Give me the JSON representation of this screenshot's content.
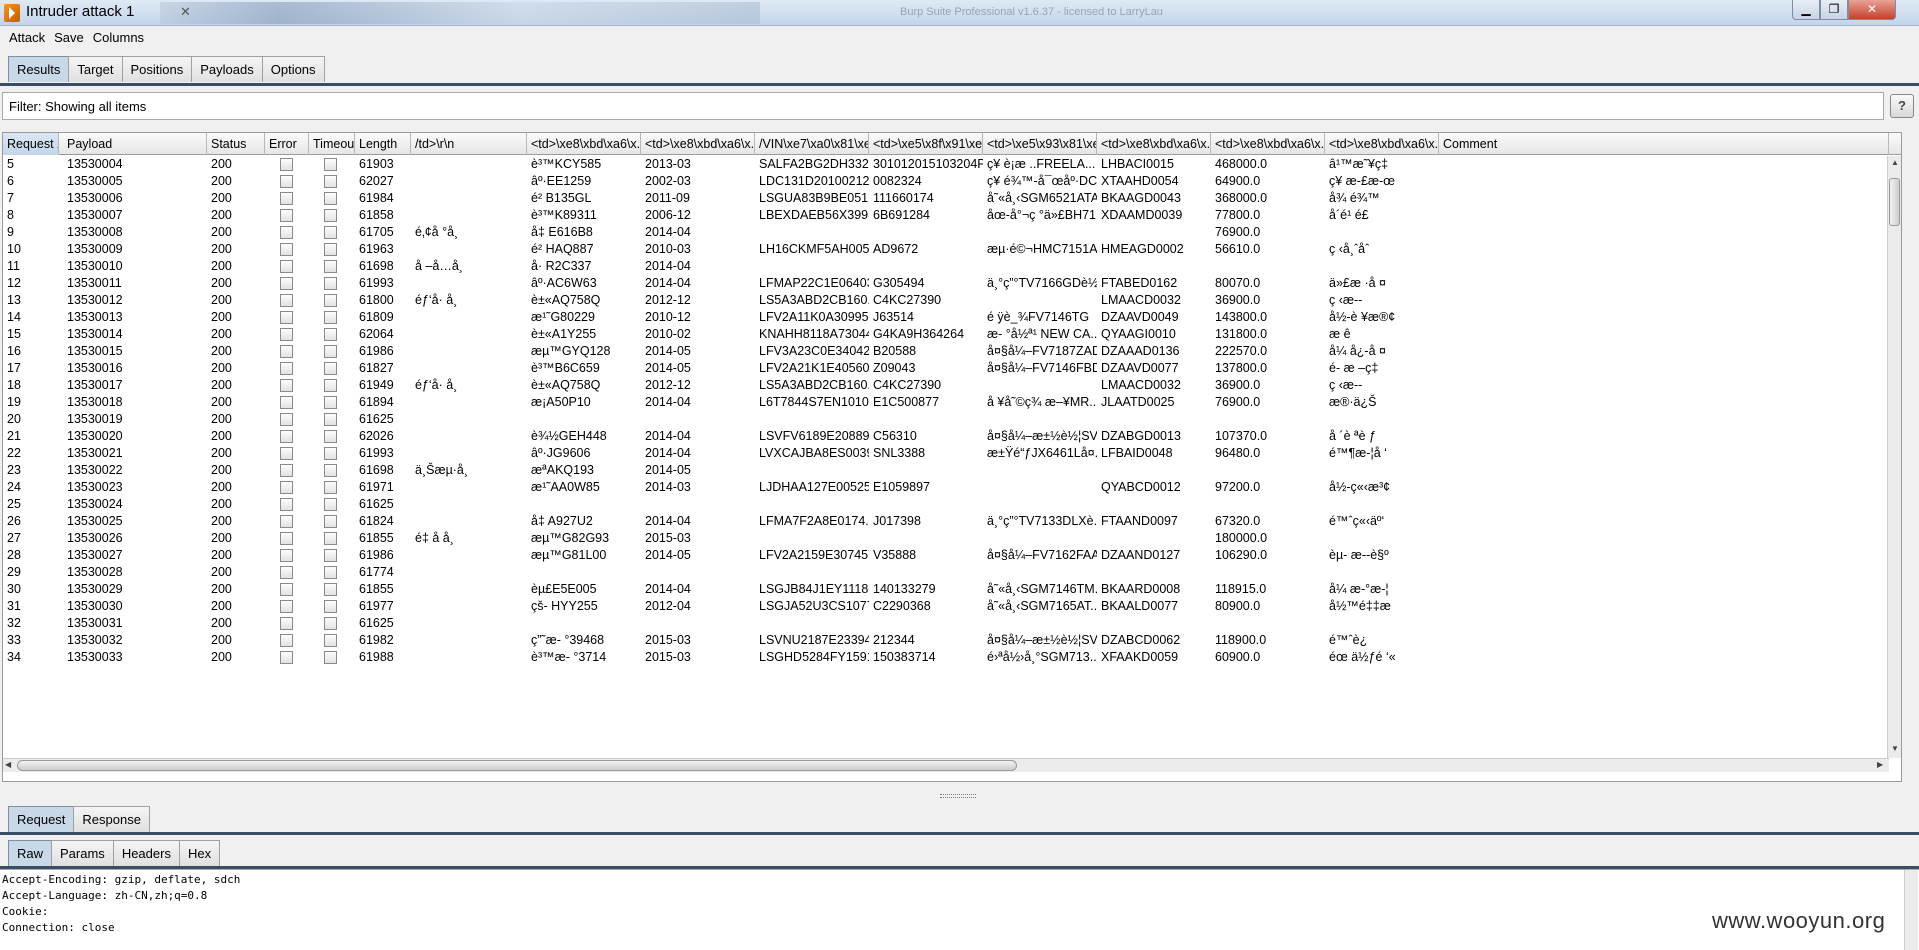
{
  "window": {
    "title": "Intruder attack 1",
    "background_title": "Burp Suite Professional v1.6.37 - licensed to LarryLau"
  },
  "menu": [
    "Attack",
    "Save",
    "Columns"
  ],
  "top_tabs": [
    "Results",
    "Target",
    "Positions",
    "Payloads",
    "Options"
  ],
  "top_tabs_active": 0,
  "filter": {
    "text": "Filter: Showing all items",
    "help": "?"
  },
  "columns": [
    "Request",
    "Payload",
    "Status",
    "Error",
    "Timeout",
    "Length",
    "/td>\\r\\n",
    "<td>\\xe8\\xbd\\xa6\\x...",
    "<td>\\xe8\\xbd\\xa6\\x...",
    "/VIN\\xe7\\xa0\\x81\\xe...",
    "<td>\\xe5\\x8f\\x91\\xe...",
    "<td>\\xe5\\x93\\x81\\xe...",
    "<td>\\xe8\\xbd\\xa6\\x...",
    "<td>\\xe8\\xbd\\xa6\\x...",
    "<td>\\xe8\\xbd\\xa6\\x...",
    "Comment"
  ],
  "rows": [
    [
      "5",
      "13530004",
      "200",
      "61903",
      "",
      "è³™KCY585",
      "2013-03",
      "SALFA2BG2DH332...",
      "301012015103204PT",
      "ç¥ è¡æ ..FREELA...",
      "LHBACI0015",
      "468000.0",
      "â¹™æ˜¥ç‡"
    ],
    [
      "6",
      "13530005",
      "200",
      "62027",
      "",
      "âº·EE1259",
      "2002-03",
      "LDC131D2010021277",
      "0082324",
      "ç¥ é¾™-å¯œåº·DC7...",
      "XTAAHD0054",
      "64900.0",
      "ç¥ æ-£æ-œ"
    ],
    [
      "7",
      "13530006",
      "200",
      "61984",
      "",
      "é² B135GL",
      "2011-09",
      "LSGUA83B9BE051...",
      "111660174",
      "å˜«å¸‹SGM6521ATA",
      "BKAAGD0043",
      "368000.0",
      "å¾ é¾™"
    ],
    [
      "8",
      "13530007",
      "200",
      "61858",
      "",
      "è³™K89311",
      "2006-12",
      "LBEXDAEB56X3993...",
      "6B691284",
      "åœ-å°¬ç °ä»£BH71...",
      "XDAAMD0039",
      "77800.0",
      "å´é¹ é£"
    ],
    [
      "9",
      "13530008",
      "200",
      "61705",
      "é‚¢å °å¸",
      "å‡ E616B8",
      "2014-04",
      "",
      "",
      "",
      "",
      "76900.0",
      ""
    ],
    [
      "10",
      "13530009",
      "200",
      "61963",
      "",
      "é² HAQ887",
      "2010-03",
      "LH16CKMF5AH005...",
      "AD9672",
      "æµ·é©¬HMC7151A...",
      "HMEAGD0002",
      "56610.0",
      "ç ‹å¸ˆåˆ"
    ],
    [
      "11",
      "13530010",
      "200",
      "61698",
      "å –å…å¸",
      "å· R2C337",
      "2014-04",
      "",
      "",
      "",
      "",
      "",
      ""
    ],
    [
      "12",
      "13530011",
      "200",
      "61993",
      "",
      "âº·AC6W63",
      "2014-04",
      "LFMAP22C1E06403...",
      "G305494",
      "ä¸°ç”°TV7166GDè½...",
      "FTABED0162",
      "80070.0",
      "ä»£æ ·å ¤"
    ],
    [
      "13",
      "13530012",
      "200",
      "61800",
      "éƒ‘å· å¸",
      "è±«AQ758Q",
      "2012-12",
      "LS5A3ABD2CB160...",
      "C4KC27390",
      "",
      "LMAACD0032",
      "36900.0",
      "ç ‹æ--"
    ],
    [
      "14",
      "13530013",
      "200",
      "61809",
      "",
      "æ¹˜G80229",
      "2010-12",
      "LFV2A11K0A3099584",
      "J63514",
      "é ÿè_¾FV7146TG",
      "DZAAVD0049",
      "143800.0",
      "å½-è ¥æ®¢"
    ],
    [
      "15",
      "13530014",
      "200",
      "62064",
      "",
      "è±«A1Y255",
      "2010-02",
      "KNAHH8118A73044...",
      "G4KA9H364264",
      "æ- °å½ª¹ NEW CA...",
      "QYAAGI0010",
      "131800.0",
      "æ  ê"
    ],
    [
      "16",
      "13530015",
      "200",
      "61986",
      "",
      "æµ™GYQ128",
      "2014-05",
      "LFV3A23C0E3404233",
      "B20588",
      "å¤§å¼–FV7187ZAD...",
      "DZAAAD0136",
      "222570.0",
      "å¼ å¿-å ¤"
    ],
    [
      "17",
      "13530016",
      "200",
      "61827",
      "",
      "è³™B6C659",
      "2014-05",
      "LFV2A21K1E4056099",
      "Z09043",
      "å¤§å¼–FV7146FBD...",
      "DZAAVD0077",
      "137800.0",
      "é- æ –ç‡"
    ],
    [
      "18",
      "13530017",
      "200",
      "61949",
      "éƒ‘å· å¸",
      "è±«AQ758Q",
      "2012-12",
      "LS5A3ABD2CB160...",
      "C4KC27390",
      "",
      "LMAACD0032",
      "36900.0",
      "ç ‹æ--"
    ],
    [
      "19",
      "13530018",
      "200",
      "61894",
      "",
      "æ¡A50P10",
      "2014-04",
      "L6T7844S7EN101087",
      "E1C500877",
      "å ¥å˜©ç¾ æ–¥MR...",
      "JLAATD0025",
      "76900.0",
      "æ®·ä¿Š"
    ],
    [
      "20",
      "13530019",
      "200",
      "61625",
      "",
      "",
      "",
      "",
      "",
      "",
      "",
      "",
      ""
    ],
    [
      "21",
      "13530020",
      "200",
      "62026",
      "",
      "è¾½GEH448",
      "2014-04",
      "LSVFV6189E2088977",
      "C56310",
      "å¤§å¼–æ±½è½¦SV...",
      "DZABGD0013",
      "107370.0",
      "å ´è ªè ƒ"
    ],
    [
      "22",
      "13530021",
      "200",
      "61993",
      "",
      "âº·JG9606",
      "2014-04",
      "LVXCAJBA8ES0039...",
      "SNL3388",
      "æ±Ÿé“ƒJX6461Lå¤...",
      "LFBAID0048",
      "96480.0",
      "é™¶æ-¦å ‘"
    ],
    [
      "23",
      "13530022",
      "200",
      "61698",
      "ä¸Šæµ·å¸",
      "æªAKQ193",
      "2014-05",
      "",
      "",
      "",
      "",
      "",
      ""
    ],
    [
      "24",
      "13530023",
      "200",
      "61971",
      "",
      "æ¹˜AA0W85",
      "2014-03",
      "LJDHAA127E0052513",
      "E1059897",
      "",
      "QYABCD0012",
      "97200.0",
      "å½-ç«‹æ³¢"
    ],
    [
      "25",
      "13530024",
      "200",
      "61625",
      "",
      "",
      "",
      "",
      "",
      "",
      "",
      "",
      ""
    ],
    [
      "26",
      "13530025",
      "200",
      "61824",
      "",
      "å‡ A927U2",
      "2014-04",
      "LFMA7F2A8E0174...",
      "J017398",
      "ä¸°ç”°TV7133DLXè...",
      "FTAAND0097",
      "67320.0",
      "é™ˆç«‹äº‘"
    ],
    [
      "27",
      "13530026",
      "200",
      "61855",
      "é‡ å  å¸",
      "æµ™G82G93",
      "2015-03",
      "",
      "",
      "",
      "",
      "180000.0",
      ""
    ],
    [
      "28",
      "13530027",
      "200",
      "61986",
      "",
      "æµ™G81L00",
      "2014-05",
      "LFV2A2159E3074575",
      "V35888",
      "å¤§å¼–FV7162FAA...",
      "DZAAND0127",
      "106290.0",
      "èµ- æ--è§º"
    ],
    [
      "29",
      "13530028",
      "200",
      "61774",
      "",
      "",
      "",
      "",
      "",
      "",
      "",
      "",
      ""
    ],
    [
      "30",
      "13530029",
      "200",
      "61855",
      "",
      "èµ£E5E005",
      "2014-04",
      "LSGJB84J1EY111802",
      "140133279",
      "å˜«å¸‹SGM7146TM...",
      "BKAARD0008",
      "118915.0",
      "å¼ æ-°æ-¦"
    ],
    [
      "31",
      "13530030",
      "200",
      "61977",
      "",
      "çš- HYY255",
      "2012-04",
      "LSGJA52U3CS1077...",
      "C2290368",
      "å˜«å¸‹SGM7165AT...",
      "BKAALD0077",
      "80900.0",
      "å½™é‡‡æ"
    ],
    [
      "32",
      "13530031",
      "200",
      "61625",
      "",
      "",
      "",
      "",
      "",
      "",
      "",
      "",
      ""
    ],
    [
      "33",
      "13530032",
      "200",
      "61982",
      "",
      "ç”˜æ- °39468",
      "2015-03",
      "LSVNU2187E2339468",
      "212344",
      "å¤§å¼–æ±½è½¦SV...",
      "DZABCD0062",
      "118900.0",
      "é™ˆè¿"
    ],
    [
      "34",
      "13530033",
      "200",
      "61988",
      "",
      "è³™æ- °3714",
      "2015-03",
      "LSGHD5284FY1591...",
      "150383714",
      "é›ªå½›å¸°SGM713...",
      "XFAAKD0059",
      "60900.0",
      "éœ ä½ƒé ‘«"
    ]
  ],
  "lower_tabs": [
    "Request",
    "Response"
  ],
  "lower_tabs_active": 0,
  "view_tabs": [
    "Raw",
    "Params",
    "Headers",
    "Hex"
  ],
  "view_tabs_active": 0,
  "raw_lines": [
    "Accept-Encoding: gzip, deflate, sdch",
    "Accept-Language: zh-CN,zh;q=0.8",
    "Cookie:",
    "Connection: close"
  ],
  "watermark": "www.wooyun.org"
}
